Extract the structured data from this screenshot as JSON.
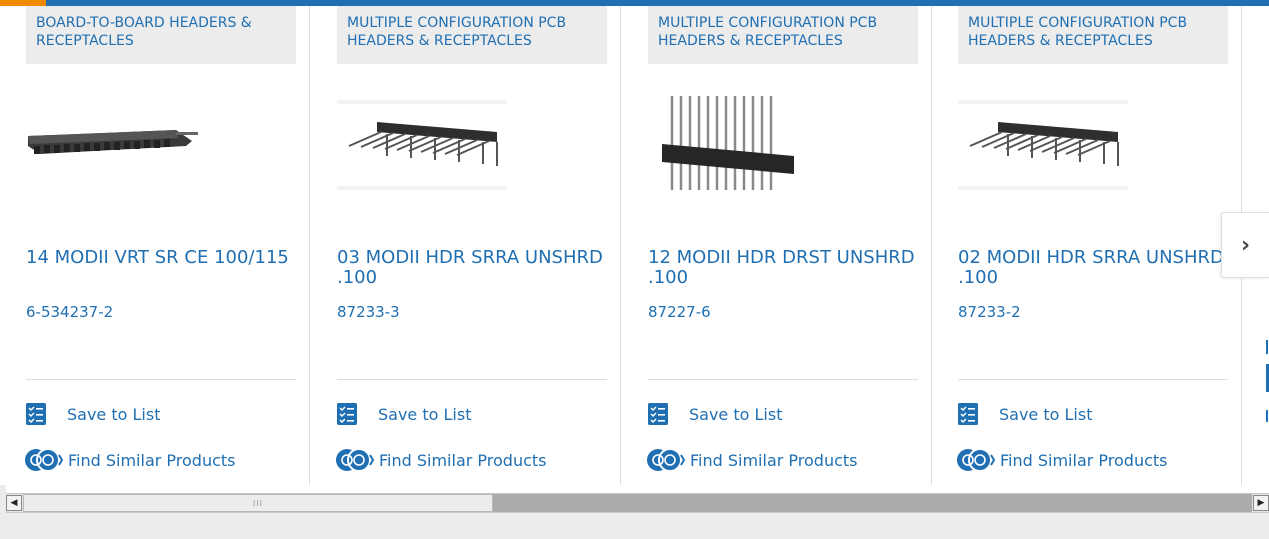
{
  "products": [
    {
      "category": "BOARD-TO-BOARD HEADERS & RECEPTACLES",
      "title": "14 MODII VRT SR CE 100/115",
      "part_number": "6-534237-2",
      "image": "board-to-board-header-image",
      "save_label": "Save to List",
      "similar_label": "Find Similar Products"
    },
    {
      "category": "MULTIPLE CONFIGURATION PCB HEADERS & RECEPTACLES",
      "title": "03 MODII HDR SRRA UNSHRD .100",
      "part_number": "87233-3",
      "image": "right-angle-header-image",
      "save_label": "Save to List",
      "similar_label": "Find Similar Products"
    },
    {
      "category": "MULTIPLE CONFIGURATION PCB HEADERS & RECEPTACLES",
      "title": "12 MODII HDR DRST UNSHRD .100",
      "part_number": "87227-6",
      "image": "dual-row-straight-header-image",
      "save_label": "Save to List",
      "similar_label": "Find Similar Products"
    },
    {
      "category": "MULTIPLE CONFIGURATION PCB HEADERS & RECEPTACLES",
      "title": "02 MODII HDR SRRA UNSHRD .100",
      "part_number": "87233-2",
      "image": "right-angle-header-image",
      "save_label": "Save to List",
      "similar_label": "Find Similar Products"
    }
  ],
  "next_button": {
    "glyph": "›",
    "icon": "chevron-right-icon"
  },
  "scrollbar": {
    "left_arrow": "◀",
    "right_arrow": "▶",
    "grip": "III",
    "thumb_position_fraction": 0.0,
    "thumb_size_fraction": 0.38
  },
  "colors": {
    "accent_blue": "#1f6fb2",
    "accent_orange": "#f08a00",
    "category_bg": "#ececec"
  }
}
